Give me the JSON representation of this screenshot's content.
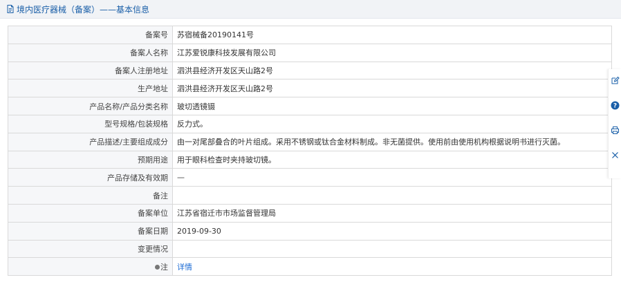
{
  "header": {
    "doc_icon": "document-icon",
    "title": "境内医疗器械（备案）——基本信息"
  },
  "rows": [
    {
      "label": "备案号",
      "value": "苏宿械备20190141号"
    },
    {
      "label": "备案人名称",
      "value": "江苏爱锐康科技发展有限公司"
    },
    {
      "label": "备案人注册地址",
      "value": "泗洪县经济开发区天山路2号"
    },
    {
      "label": "生产地址",
      "value": "泗洪县经济开发区天山路2号"
    },
    {
      "label": "产品名称/产品分类名称",
      "value": "玻切透镜镊"
    },
    {
      "label": "型号规格/包装规格",
      "value": "反力式。"
    },
    {
      "label": "产品描述/主要组成成分",
      "value": "由一对尾部叠合的叶片组成。采用不锈钢或钛合金材料制成。非无菌提供。使用前由使用机构根据说明书进行灭菌。"
    },
    {
      "label": "预期用途",
      "value": "用于眼科检查时夹持玻切镜。"
    },
    {
      "label": "产品存储及有效期",
      "value": "—"
    },
    {
      "label": "备注",
      "value": ""
    },
    {
      "label": "备案单位",
      "value": "江苏省宿迁市市场监督管理局"
    },
    {
      "label": "备案日期",
      "value": "2019-09-30"
    },
    {
      "label": "变更情况",
      "value": ""
    }
  ],
  "note_row": {
    "label": "注",
    "icon": "info-dot-icon",
    "link_text": "详情"
  },
  "side_toolbar": {
    "icons": [
      "edit-icon",
      "help-icon",
      "print-icon",
      "close-icon"
    ],
    "accent": "#1a5fa8"
  }
}
